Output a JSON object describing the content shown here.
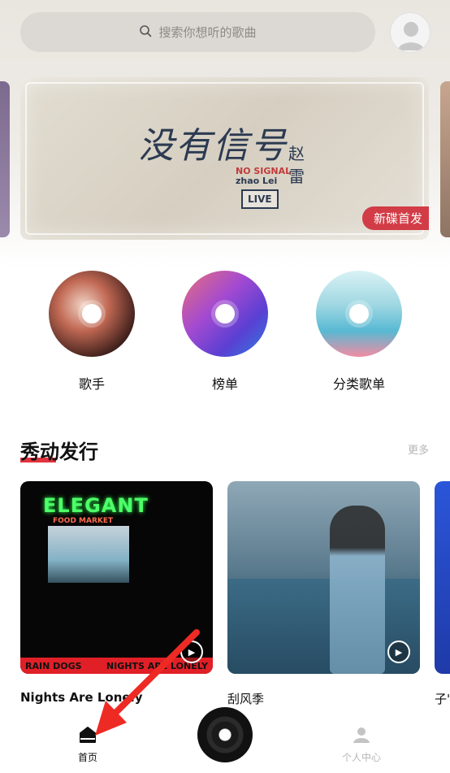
{
  "search": {
    "placeholder": "搜索你想听的歌曲"
  },
  "banner": {
    "title": "没有信号",
    "artist": "赵雷",
    "subtitle_line1": "NO SIGNAL",
    "subtitle_line2": "zhao Lei",
    "live_label": "LIVE",
    "tag": "新碟首发"
  },
  "categories": [
    {
      "label": "歌手"
    },
    {
      "label": "榜单"
    },
    {
      "label": "分类歌单"
    }
  ],
  "section": {
    "title": "秀动发行",
    "more_label": "更多"
  },
  "albums": [
    {
      "name": "Nights Are Lonely",
      "cover_sign": "ELEGANT",
      "cover_sub": "FOOD MARKET",
      "strip_left": "RAIN DOGS",
      "strip_right": "NIGHTS ARE LONELY"
    },
    {
      "name": "刮风季"
    },
    {
      "name": "子'"
    }
  ],
  "nav": {
    "home_label": "首页",
    "me_label": "个人中心"
  },
  "colors": {
    "accent": "#e2333d",
    "tag": "#d23c46",
    "muted": "#b7b7b7"
  }
}
